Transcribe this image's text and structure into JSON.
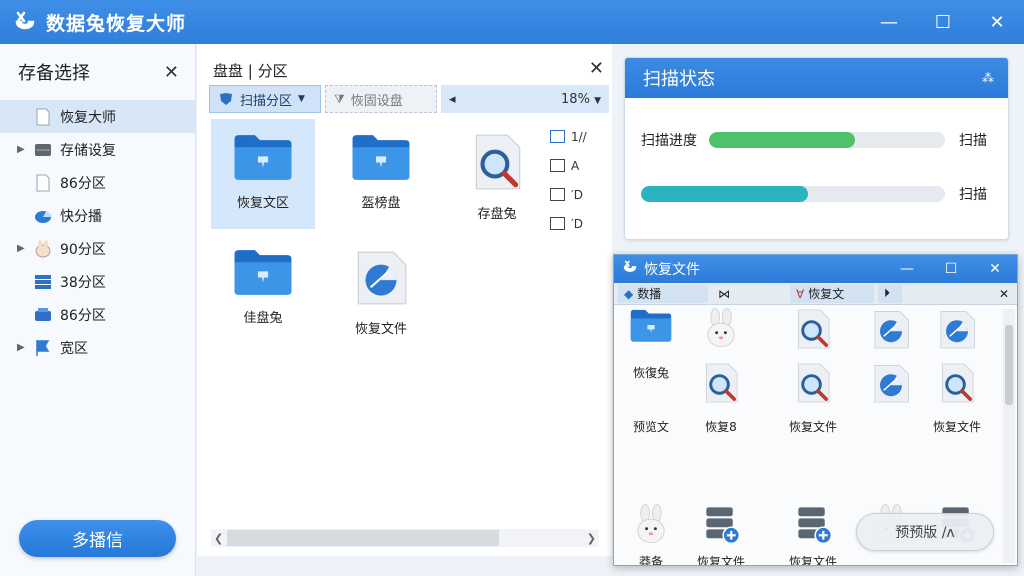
{
  "app": {
    "title": "数据兔恢复大师"
  },
  "sidebar": {
    "title": "存备选择",
    "items": [
      {
        "label": "恢复大师",
        "active": true,
        "icon": "document-icon"
      },
      {
        "label": "存储设复",
        "expandable": true,
        "icon": "drive-icon"
      },
      {
        "label": "86分区",
        "icon": "document-icon"
      },
      {
        "label": "快分播",
        "icon": "pie-icon"
      },
      {
        "label": "90分区",
        "expandable": true,
        "icon": "rabbit-icon"
      },
      {
        "label": "38分区",
        "icon": "list-icon"
      },
      {
        "label": "86分区",
        "icon": "drive-blue-icon"
      },
      {
        "label": "宽区",
        "expandable": true,
        "icon": "flag-icon"
      }
    ],
    "button": "多播信"
  },
  "center": {
    "path": "盘盘 | 分区",
    "toolbar": {
      "scan": "扫描分区",
      "settings": "恢固设盘",
      "zoom": "18%"
    },
    "files": [
      {
        "label": "恢复文区",
        "icon": "folder-icon"
      },
      {
        "label": "盔榜盘",
        "icon": "folder-icon"
      },
      {
        "label": "存盘兔",
        "icon": "search-file-icon"
      },
      {
        "label": "佳盘兔",
        "icon": "folder-icon"
      },
      {
        "label": "恢复文件",
        "icon": "pie-file-icon"
      }
    ],
    "side_list": [
      "1//",
      "A",
      "′D",
      "′D"
    ]
  },
  "scan_status": {
    "title": "扫描状态",
    "progress_label": "扫描进度",
    "row1_suffix": "扫描",
    "row2_suffix": "扫描",
    "progress1": 0.62,
    "progress2": 0.55,
    "color1": "#4cc36a",
    "color2": "#2bb3c0"
  },
  "float_window": {
    "title": "恢复文件",
    "tab1": "数播",
    "tab2": "恢复文",
    "items": [
      {
        "label": "",
        "icon": "folder-icon"
      },
      {
        "label": "",
        "icon": "rabbit-icon"
      },
      {
        "label": "",
        "icon": "search-file-icon"
      },
      {
        "label": "",
        "icon": "pie-file-icon"
      },
      {
        "label": "",
        "icon": "pie-file-icon"
      },
      {
        "label": "恢復兔",
        "icon": ""
      },
      {
        "label": "",
        "icon": "search-file-icon"
      },
      {
        "label": "",
        "icon": "search-file-icon"
      },
      {
        "label": "",
        "icon": "pie-file-icon"
      },
      {
        "label": "",
        "icon": "search-file-icon"
      },
      {
        "label": "预览文",
        "icon": ""
      },
      {
        "label": "恢复8",
        "icon": ""
      },
      {
        "label": "恢复文件",
        "icon": ""
      },
      {
        "label": "",
        "icon": ""
      },
      {
        "label": "恢复文件",
        "icon": ""
      },
      {
        "label": "莽备",
        "icon": "rabbit-icon"
      },
      {
        "label": "恢复文件",
        "icon": "server-icon"
      },
      {
        "label": "恢复文件",
        "icon": "server-icon"
      },
      {
        "label": "",
        "icon": "rabbit-icon"
      },
      {
        "label": "",
        "icon": "server-icon"
      }
    ],
    "pill": "预预版 /ʌ"
  }
}
